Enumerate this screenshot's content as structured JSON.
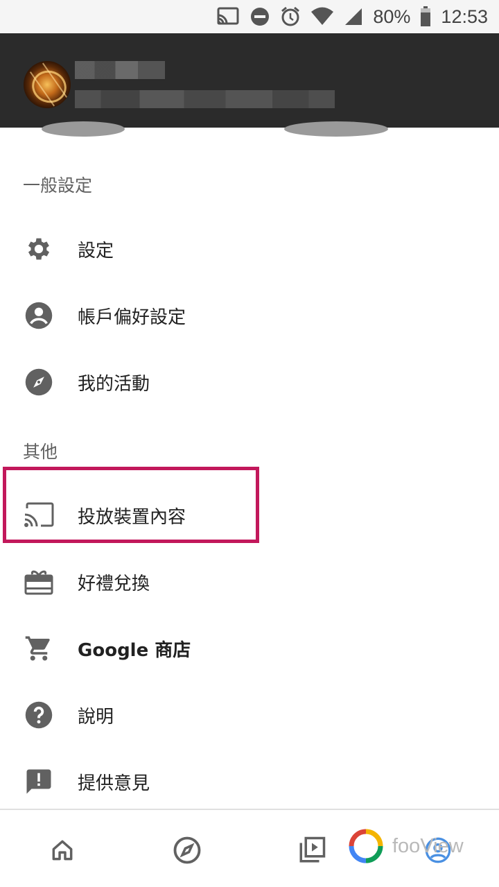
{
  "status_bar": {
    "battery": "80%",
    "time": "12:53",
    "icons": [
      "cast-icon",
      "do-not-disturb-icon",
      "alarm-icon",
      "wifi-icon",
      "signal-icon",
      "battery-icon"
    ]
  },
  "account": {
    "avatar": "avatar-image"
  },
  "sections": {
    "general": "一般設定",
    "other": "其他"
  },
  "menu": {
    "settings": {
      "label": "設定",
      "icon": "gear-icon"
    },
    "account_prefs": {
      "label": "帳戶偏好設定",
      "icon": "account-circle-icon"
    },
    "my_activity": {
      "label": "我的活動",
      "icon": "compass-icon"
    },
    "cast": {
      "label": "投放裝置內容",
      "icon": "cast-icon"
    },
    "redeem": {
      "label": "好禮兌換",
      "icon": "gift-card-icon"
    },
    "store": {
      "label": "Google 商店",
      "icon": "cart-icon"
    },
    "help": {
      "label": "說明",
      "icon": "help-icon"
    },
    "feedback": {
      "label": "提供意見",
      "icon": "feedback-icon"
    }
  },
  "highlight_color": "#c2185b",
  "bottom_nav": {
    "items": [
      "home-icon",
      "explore-icon",
      "video-library-icon",
      "account-icon"
    ],
    "watermark": "fooView"
  }
}
